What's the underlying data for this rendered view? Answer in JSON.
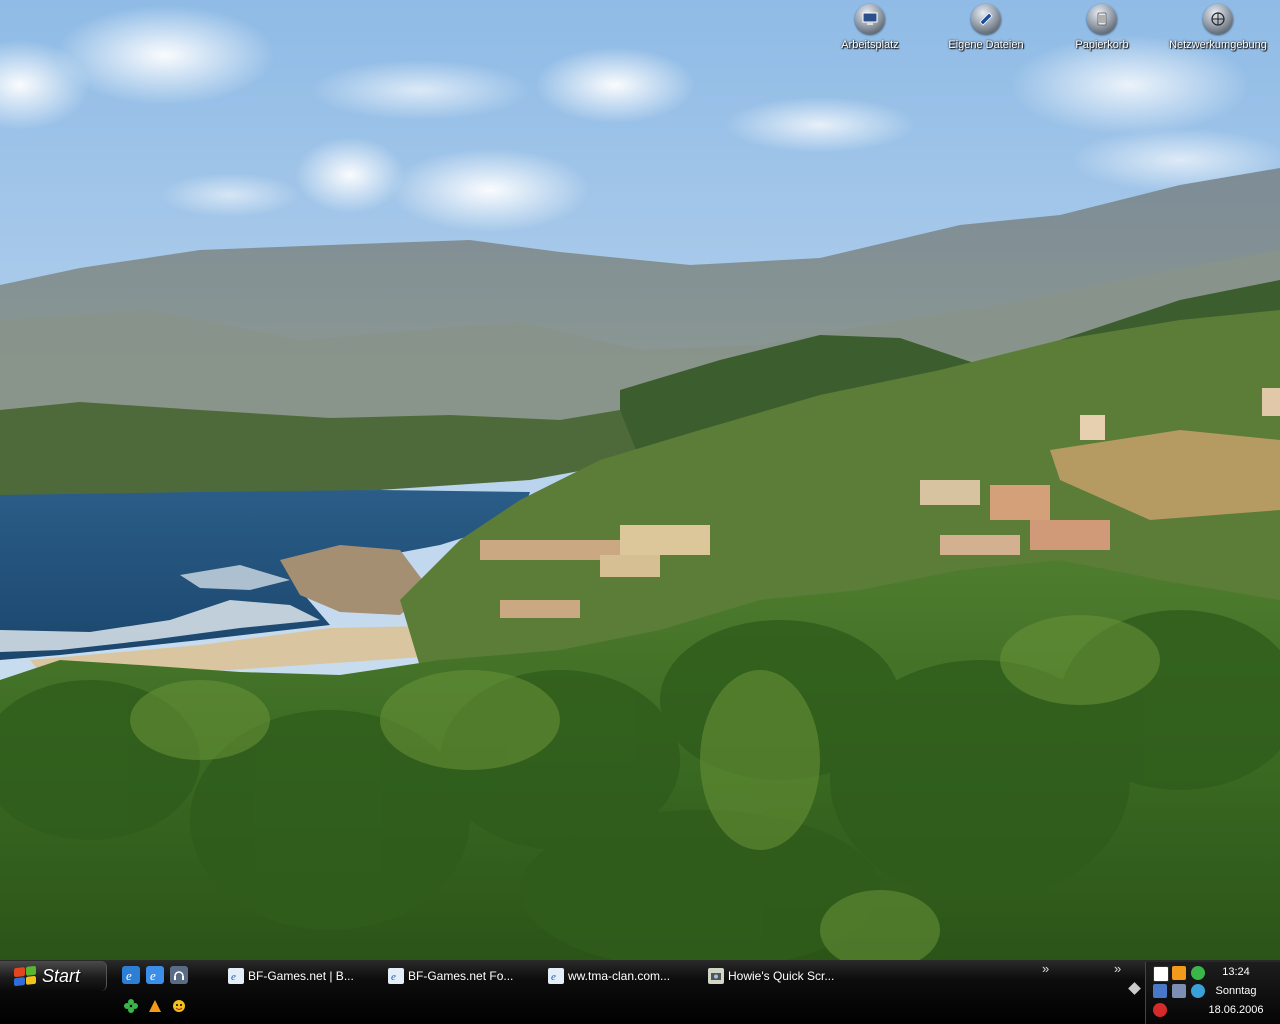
{
  "desktop": {
    "icons": [
      {
        "label": "Arbeitsplatz",
        "icon": "my-computer-icon"
      },
      {
        "label": "Eigene Dateien",
        "icon": "my-documents-icon"
      },
      {
        "label": "Papierkorb",
        "icon": "recycle-bin-icon"
      },
      {
        "label": "Netzwerkumgebung",
        "icon": "network-places-icon"
      }
    ]
  },
  "taskbar": {
    "start_label": "Start",
    "quick_launch": [
      "ie-icon",
      "ie-icon",
      "media-player-icon",
      "clover-icon",
      "app-icon",
      "messenger-icon"
    ],
    "tasks": [
      {
        "label": "BF-Games.net | B...",
        "icon": "ie-page-icon"
      },
      {
        "label": "BF-Games.net Fo...",
        "icon": "ie-page-icon"
      },
      {
        "label": "ww.tma-clan.com...",
        "icon": "ie-page-icon"
      },
      {
        "label": "Howie's Quick Scr...",
        "icon": "camera-icon"
      }
    ],
    "overflow_chevrons": [
      "»",
      "»"
    ]
  },
  "tray": {
    "time": "13:24",
    "day": "Sonntag",
    "date": "18.06.2006",
    "icons": [
      "calendar-icon",
      "winamp-icon",
      "clover-icon",
      "network-icon",
      "display-icon",
      "sync-icon",
      "antivirus-icon"
    ]
  },
  "colors": {
    "sky_top": "#9fc4e8",
    "sea": "#1f4f7c",
    "forest": "#3f6b25",
    "taskbar": "#000000"
  }
}
